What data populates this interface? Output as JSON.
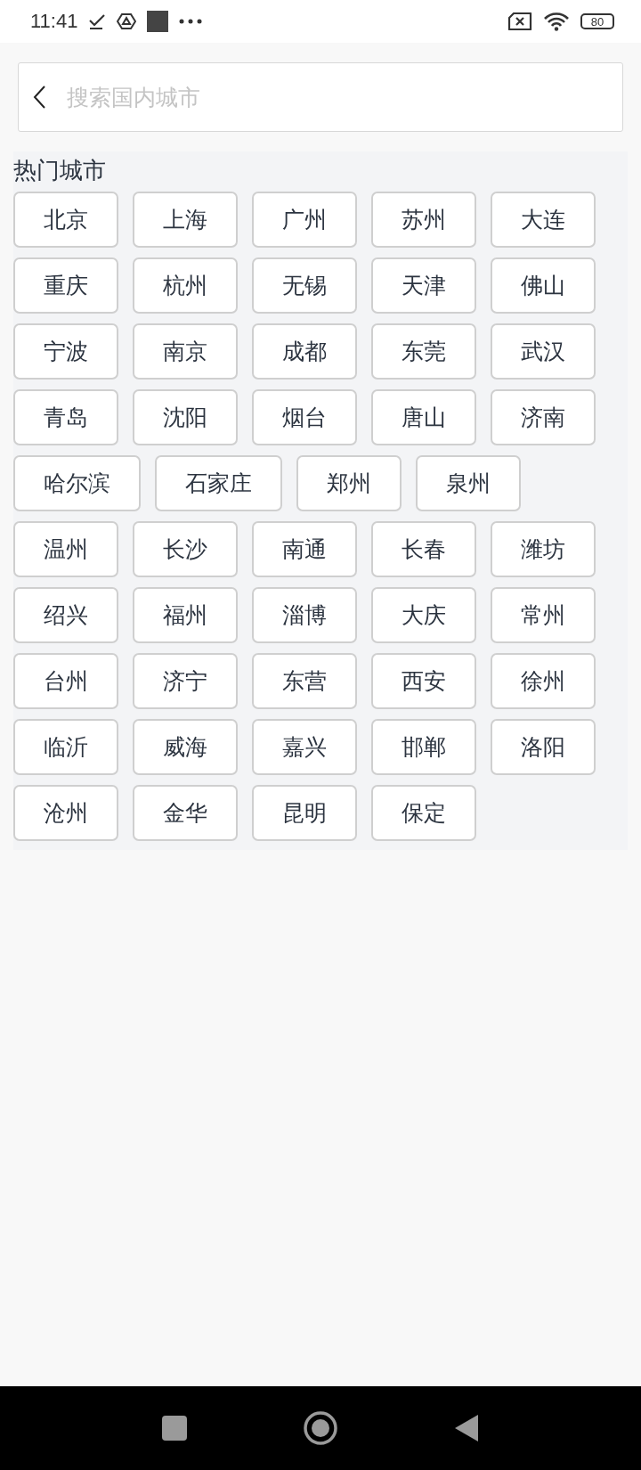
{
  "status_bar": {
    "time": "11:41",
    "battery": "80"
  },
  "search": {
    "placeholder": "搜索国内城市"
  },
  "hot_cities": {
    "title": "热门城市",
    "cities": [
      "北京",
      "上海",
      "广州",
      "苏州",
      "大连",
      "重庆",
      "杭州",
      "无锡",
      "天津",
      "佛山",
      "宁波",
      "南京",
      "成都",
      "东莞",
      "武汉",
      "青岛",
      "沈阳",
      "烟台",
      "唐山",
      "济南",
      "哈尔滨",
      "石家庄",
      "郑州",
      "泉州",
      "温州",
      "长沙",
      "南通",
      "长春",
      "潍坊",
      "绍兴",
      "福州",
      "淄博",
      "大庆",
      "常州",
      "台州",
      "济宁",
      "东营",
      "西安",
      "徐州",
      "临沂",
      "威海",
      "嘉兴",
      "邯郸",
      "洛阳",
      "沧州",
      "金华",
      "昆明",
      "保定"
    ]
  }
}
